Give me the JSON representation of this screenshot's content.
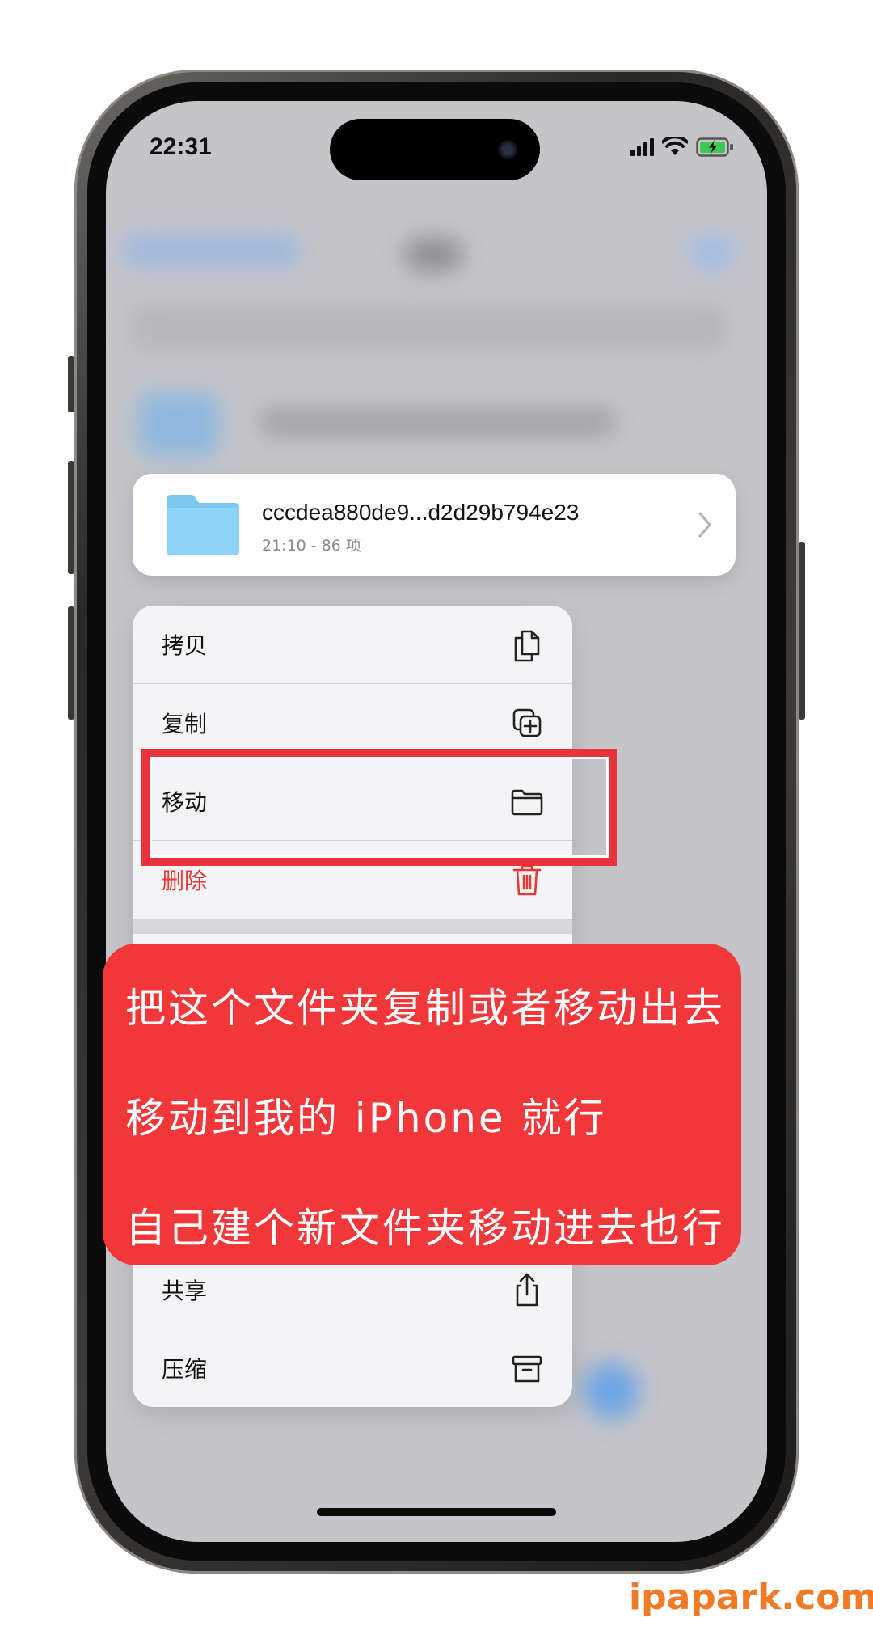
{
  "status_bar": {
    "time": "22:31",
    "icons": [
      "signal-icon",
      "wifi-icon",
      "battery-charging-icon"
    ]
  },
  "file_card": {
    "name": "cccdea880de9...d2d29b794e23",
    "meta": "21:10 - 86 项",
    "icon": "folder-icon"
  },
  "context_menu": {
    "items": [
      {
        "label": "拷贝",
        "icon": "copy-icon"
      },
      {
        "label": "复制",
        "icon": "duplicate-icon"
      },
      {
        "label": "移动",
        "icon": "folder-move-icon"
      },
      {
        "label": "删除",
        "icon": "trash-icon",
        "destructive": true
      },
      {
        "label": "共享",
        "icon": "share-icon"
      },
      {
        "label": "压缩",
        "icon": "archive-icon"
      }
    ]
  },
  "caption": {
    "lines": [
      "把这个文件夹复制或者移动出去",
      "移动到我的 iPhone 就行",
      "自己建个新文件夹移动进去也行"
    ]
  },
  "watermark": "ipapark.com",
  "colors": {
    "highlight": "#e8333d",
    "caption_bg": "#f2373a",
    "folder_blue": "#7cc7f2",
    "destructive": "#e53935",
    "watermark": "#f07a26"
  }
}
